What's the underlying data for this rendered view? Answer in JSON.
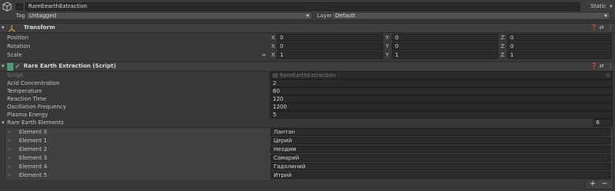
{
  "object": {
    "name": "RareEearthExtraction",
    "static_label": "Static",
    "tag_label": "Tag",
    "tag_value": "Untagged",
    "layer_label": "Layer",
    "layer_value": "Default"
  },
  "transform": {
    "title": "Transform",
    "rows": [
      {
        "label": "Position",
        "x": "0",
        "y": "0",
        "z": "0"
      },
      {
        "label": "Rotation",
        "x": "0",
        "y": "0",
        "z": "0"
      },
      {
        "label": "Scale",
        "x": "1",
        "y": "1",
        "z": "1"
      }
    ],
    "axis": {
      "x": "X",
      "y": "Y",
      "z": "Z"
    }
  },
  "script_component": {
    "title": "Rare Earth Extraction (Script)",
    "script_label": "Script",
    "script_value": "RareEarthExtraction",
    "fields": [
      {
        "label": "Acid Concentration",
        "value": "2"
      },
      {
        "label": "Temperature",
        "value": "60"
      },
      {
        "label": "Reaction Time",
        "value": "120"
      },
      {
        "label": "Oscillation Frequency",
        "value": "1200"
      },
      {
        "label": "Plasma Energy",
        "value": "5"
      }
    ],
    "list_label": "Rare Earth Elements",
    "list_count": "6",
    "elements": [
      {
        "label": "Element 0",
        "value": "Лантан"
      },
      {
        "label": "Element 1",
        "value": "Церий"
      },
      {
        "label": "Element 2",
        "value": "Неодим"
      },
      {
        "label": "Element 3",
        "value": "Самарий"
      },
      {
        "label": "Element 4",
        "value": "Гадолиний"
      },
      {
        "label": "Element 5",
        "value": "Итрий"
      }
    ],
    "add_button": "+",
    "remove_button": "−"
  },
  "icons": {
    "gameobject": "cube-icon",
    "transform": "transform-axes-icon",
    "script": "script-file-icon",
    "help": "help-icon",
    "presets": "presets-icon",
    "menu": "kebab-menu-icon",
    "link": "constrain-proportions-icon",
    "foldout": "foldout-arrow-icon",
    "object_picker": "object-picker-icon"
  },
  "colors": {
    "panel": "#383838",
    "field": "#2a2a2a",
    "header": "#3e3e3e",
    "checkbox_accent": "#dcdcdc"
  }
}
